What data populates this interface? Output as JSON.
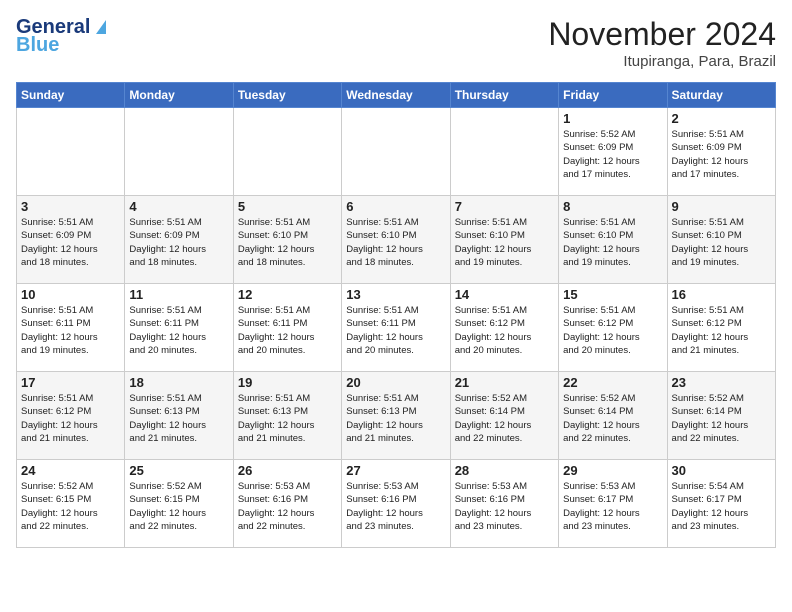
{
  "header": {
    "logo_line1": "General",
    "logo_line2": "Blue",
    "month": "November 2024",
    "location": "Itupiranga, Para, Brazil"
  },
  "weekdays": [
    "Sunday",
    "Monday",
    "Tuesday",
    "Wednesday",
    "Thursday",
    "Friday",
    "Saturday"
  ],
  "weeks": [
    [
      {
        "day": "",
        "info": ""
      },
      {
        "day": "",
        "info": ""
      },
      {
        "day": "",
        "info": ""
      },
      {
        "day": "",
        "info": ""
      },
      {
        "day": "",
        "info": ""
      },
      {
        "day": "1",
        "info": "Sunrise: 5:52 AM\nSunset: 6:09 PM\nDaylight: 12 hours\nand 17 minutes."
      },
      {
        "day": "2",
        "info": "Sunrise: 5:51 AM\nSunset: 6:09 PM\nDaylight: 12 hours\nand 17 minutes."
      }
    ],
    [
      {
        "day": "3",
        "info": "Sunrise: 5:51 AM\nSunset: 6:09 PM\nDaylight: 12 hours\nand 18 minutes."
      },
      {
        "day": "4",
        "info": "Sunrise: 5:51 AM\nSunset: 6:09 PM\nDaylight: 12 hours\nand 18 minutes."
      },
      {
        "day": "5",
        "info": "Sunrise: 5:51 AM\nSunset: 6:10 PM\nDaylight: 12 hours\nand 18 minutes."
      },
      {
        "day": "6",
        "info": "Sunrise: 5:51 AM\nSunset: 6:10 PM\nDaylight: 12 hours\nand 18 minutes."
      },
      {
        "day": "7",
        "info": "Sunrise: 5:51 AM\nSunset: 6:10 PM\nDaylight: 12 hours\nand 19 minutes."
      },
      {
        "day": "8",
        "info": "Sunrise: 5:51 AM\nSunset: 6:10 PM\nDaylight: 12 hours\nand 19 minutes."
      },
      {
        "day": "9",
        "info": "Sunrise: 5:51 AM\nSunset: 6:10 PM\nDaylight: 12 hours\nand 19 minutes."
      }
    ],
    [
      {
        "day": "10",
        "info": "Sunrise: 5:51 AM\nSunset: 6:11 PM\nDaylight: 12 hours\nand 19 minutes."
      },
      {
        "day": "11",
        "info": "Sunrise: 5:51 AM\nSunset: 6:11 PM\nDaylight: 12 hours\nand 20 minutes."
      },
      {
        "day": "12",
        "info": "Sunrise: 5:51 AM\nSunset: 6:11 PM\nDaylight: 12 hours\nand 20 minutes."
      },
      {
        "day": "13",
        "info": "Sunrise: 5:51 AM\nSunset: 6:11 PM\nDaylight: 12 hours\nand 20 minutes."
      },
      {
        "day": "14",
        "info": "Sunrise: 5:51 AM\nSunset: 6:12 PM\nDaylight: 12 hours\nand 20 minutes."
      },
      {
        "day": "15",
        "info": "Sunrise: 5:51 AM\nSunset: 6:12 PM\nDaylight: 12 hours\nand 20 minutes."
      },
      {
        "day": "16",
        "info": "Sunrise: 5:51 AM\nSunset: 6:12 PM\nDaylight: 12 hours\nand 21 minutes."
      }
    ],
    [
      {
        "day": "17",
        "info": "Sunrise: 5:51 AM\nSunset: 6:12 PM\nDaylight: 12 hours\nand 21 minutes."
      },
      {
        "day": "18",
        "info": "Sunrise: 5:51 AM\nSunset: 6:13 PM\nDaylight: 12 hours\nand 21 minutes."
      },
      {
        "day": "19",
        "info": "Sunrise: 5:51 AM\nSunset: 6:13 PM\nDaylight: 12 hours\nand 21 minutes."
      },
      {
        "day": "20",
        "info": "Sunrise: 5:51 AM\nSunset: 6:13 PM\nDaylight: 12 hours\nand 21 minutes."
      },
      {
        "day": "21",
        "info": "Sunrise: 5:52 AM\nSunset: 6:14 PM\nDaylight: 12 hours\nand 22 minutes."
      },
      {
        "day": "22",
        "info": "Sunrise: 5:52 AM\nSunset: 6:14 PM\nDaylight: 12 hours\nand 22 minutes."
      },
      {
        "day": "23",
        "info": "Sunrise: 5:52 AM\nSunset: 6:14 PM\nDaylight: 12 hours\nand 22 minutes."
      }
    ],
    [
      {
        "day": "24",
        "info": "Sunrise: 5:52 AM\nSunset: 6:15 PM\nDaylight: 12 hours\nand 22 minutes."
      },
      {
        "day": "25",
        "info": "Sunrise: 5:52 AM\nSunset: 6:15 PM\nDaylight: 12 hours\nand 22 minutes."
      },
      {
        "day": "26",
        "info": "Sunrise: 5:53 AM\nSunset: 6:16 PM\nDaylight: 12 hours\nand 22 minutes."
      },
      {
        "day": "27",
        "info": "Sunrise: 5:53 AM\nSunset: 6:16 PM\nDaylight: 12 hours\nand 23 minutes."
      },
      {
        "day": "28",
        "info": "Sunrise: 5:53 AM\nSunset: 6:16 PM\nDaylight: 12 hours\nand 23 minutes."
      },
      {
        "day": "29",
        "info": "Sunrise: 5:53 AM\nSunset: 6:17 PM\nDaylight: 12 hours\nand 23 minutes."
      },
      {
        "day": "30",
        "info": "Sunrise: 5:54 AM\nSunset: 6:17 PM\nDaylight: 12 hours\nand 23 minutes."
      }
    ]
  ]
}
